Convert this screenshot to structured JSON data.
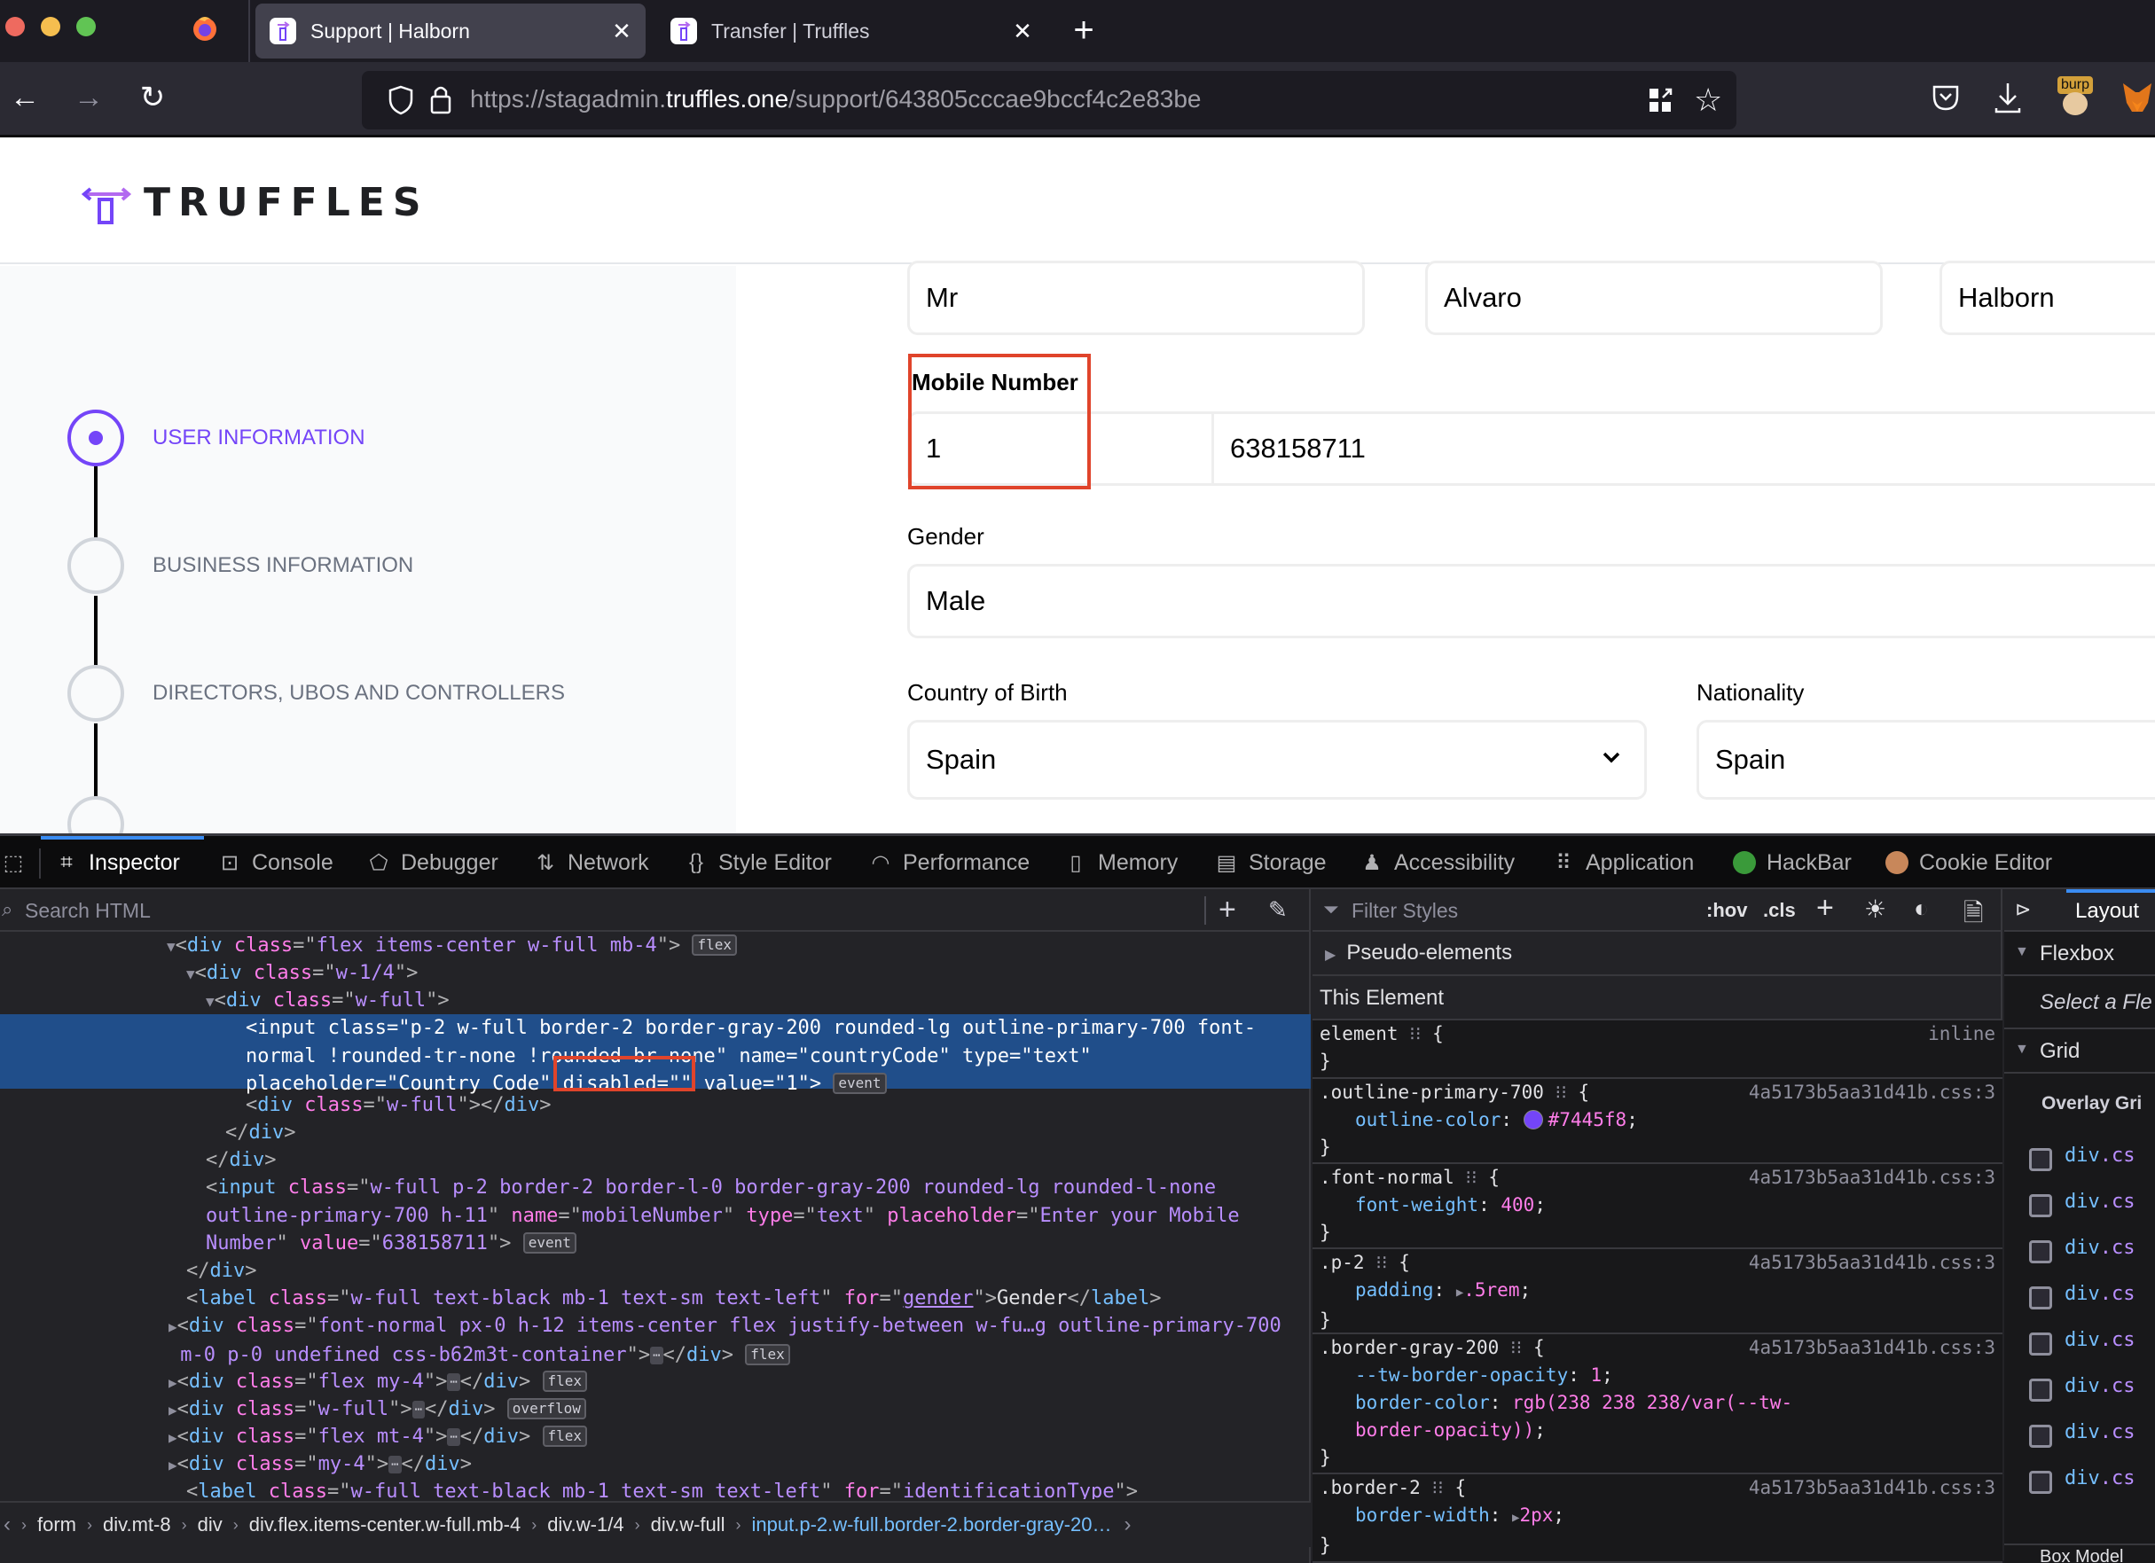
{
  "browser": {
    "tabs": [
      {
        "label": "Support | Halborn",
        "active": true
      },
      {
        "label": "Transfer | Truffles",
        "active": false
      }
    ],
    "url_prefix": "https://stagadmin.",
    "url_host": "truffles.one",
    "url_path": "/support/643805cccae9bccf4c2e83be",
    "extensions": [
      "pocket-icon",
      "download-icon",
      "burp-extension-icon",
      "metamask-icon"
    ],
    "burp_label": "burp"
  },
  "app": {
    "logo_text": "TRUFFLES",
    "accent_color": "#7445f8"
  },
  "sidebar": {
    "steps": [
      {
        "label": "USER INFORMATION",
        "active": true
      },
      {
        "label": "BUSINESS INFORMATION",
        "active": false
      },
      {
        "label": "DIRECTORS, UBOS AND CONTROLLERS",
        "active": false
      }
    ]
  },
  "form": {
    "title_value": "Mr",
    "first_name_value": "Alvaro",
    "last_name_value": "Halborn",
    "mobile_label": "Mobile Number",
    "country_code_value": "1",
    "mobile_number_value": "638158711",
    "gender_label": "Gender",
    "gender_value": "Male",
    "country_of_birth_label": "Country of Birth",
    "country_of_birth_value": "Spain",
    "nationality_label": "Nationality",
    "nationality_value": "Spain"
  },
  "devtools": {
    "tabs": [
      "Inspector",
      "Console",
      "Debugger",
      "Network",
      "Style Editor",
      "Performance",
      "Memory",
      "Storage",
      "Accessibility",
      "Application",
      "HackBar",
      "Cookie Editor"
    ],
    "active_tab": "Inspector",
    "search_html_placeholder": "Search HTML",
    "filter_styles_placeholder": "Filter Styles",
    "hov_label": ":hov",
    "cls_label": ".cls",
    "layout_tab": "Layout",
    "html_tree": {
      "l1": {
        "tag": "div",
        "class": "flex items-center w-full mb-4",
        "badge": "flex"
      },
      "l2": {
        "tag": "div",
        "class": "w-1/4"
      },
      "l3": {
        "tag": "div",
        "class": "w-full"
      },
      "sel_line1": "p-2 w-full border-2 border-gray-200 rounded-lg outline-primary-700 font-",
      "sel_line2a": "normal !rounded-tr-none !rounded-br-none",
      "sel_name": "countryCode",
      "sel_type": "text",
      "sel_placeholder": "Country Code",
      "sel_disabled": "disabled=\"\"",
      "sel_value": "1",
      "event_badge": "event",
      "l5": {
        "tag": "div",
        "class": "w-full"
      },
      "l8_class1": "w-full p-2 border-2 border-l-0 border-gray-200 rounded-lg rounded-l-none",
      "l8_class2": "outline-primary-700 h-11",
      "l8_name": "mobileNumber",
      "l8_type": "text",
      "l8_placeholder1": "Enter your Mobile",
      "l8_placeholder2": "Number",
      "l8_value": "638158711",
      "label_class": "w-full text-black mb-1 text-sm text-left",
      "label_for_gender": "gender",
      "label_text_gender": "Gender",
      "l11_class1": "font-normal px-0 h-12 items-center flex justify-between w-fu…g outline-primary-700",
      "l11_class2": "m-0 p-0 undefined css-b62m3t-container",
      "collapsed": [
        {
          "class": "flex my-4",
          "badge": "flex"
        },
        {
          "class": "w-full",
          "badge": "overflow"
        },
        {
          "class": "flex mt-4",
          "badge": "flex"
        },
        {
          "class": "my-4",
          "badge": ""
        }
      ],
      "label_for_id": "identificationType"
    },
    "breadcrumb": [
      "form",
      "div.mt-8",
      "div",
      "div.flex.items-center.w-full.mb-4",
      "div.w-1/4",
      "div.w-full",
      "input.p-2.w-full.border-2.border-gray-20…"
    ],
    "styles": {
      "pseudo_elements": "Pseudo-elements",
      "this_element": "This Element",
      "source": "4a5173b5aa31d41b.css:3",
      "inline": "inline",
      "rules": [
        {
          "selector": "element",
          "decls": []
        },
        {
          "selector": ".outline-primary-700",
          "decls": [
            {
              "prop": "outline-color",
              "value": "#7445f8"
            }
          ]
        },
        {
          "selector": ".font-normal",
          "decls": [
            {
              "prop": "font-weight",
              "value": "400"
            }
          ]
        },
        {
          "selector": ".p-2",
          "decls": [
            {
              "prop": "padding",
              "value": ".5rem"
            }
          ]
        },
        {
          "selector": ".border-gray-200",
          "decls": [
            {
              "prop": "--tw-border-opacity",
              "value": "1"
            },
            {
              "prop": "border-color",
              "value": "rgb(238 238 238/var(--tw-border-opacity))"
            }
          ]
        },
        {
          "selector": ".border-2",
          "decls": [
            {
              "prop": "border-width",
              "value": "2px"
            }
          ]
        }
      ]
    },
    "layout": {
      "flexbox": "Flexbox",
      "flexbox_hint": "Select a Fle",
      "grid": "Grid",
      "overlay_grid": "Overlay Gri",
      "grid_items": [
        "div.cs",
        "div.cs",
        "div.cs",
        "div.cs",
        "div.cs",
        "div.cs",
        "div.cs",
        "div.cs"
      ],
      "box_model": "Box Model"
    }
  }
}
